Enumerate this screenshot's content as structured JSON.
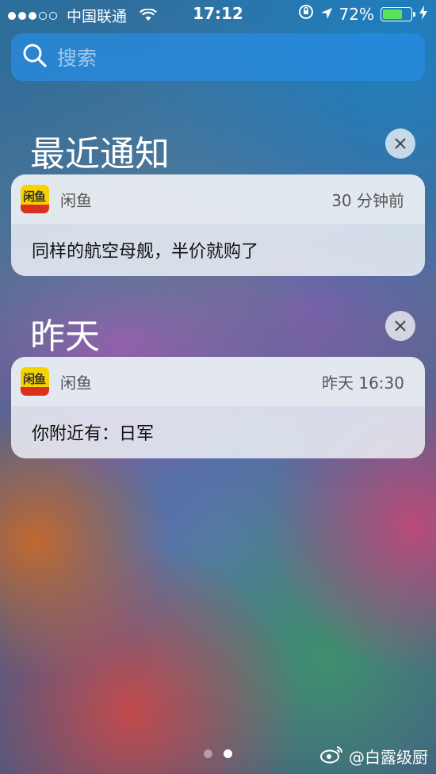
{
  "status_bar": {
    "carrier": "中国联通",
    "time": "17:12",
    "battery": "72%",
    "battery_level": 0.72,
    "signal_dots_filled": 3
  },
  "search": {
    "placeholder": "搜索"
  },
  "sections": [
    {
      "title": "最近通知",
      "notifications": [
        {
          "app_name": "闲鱼",
          "time": "30 分钟前",
          "message": "同样的航空母舰，半价就购了"
        }
      ]
    },
    {
      "title": "昨天",
      "notifications": [
        {
          "app_name": "闲鱼",
          "time": "昨天 16:30",
          "message": "你附近有：日军"
        }
      ]
    }
  ],
  "page_indicator": {
    "count": 2,
    "active": 1
  },
  "watermark": {
    "text": "@白露级厨"
  },
  "colors": {
    "accent": "#2b8ce1",
    "battery_green": "#5ce35c",
    "app_icon_yellow": "#f5d200"
  }
}
